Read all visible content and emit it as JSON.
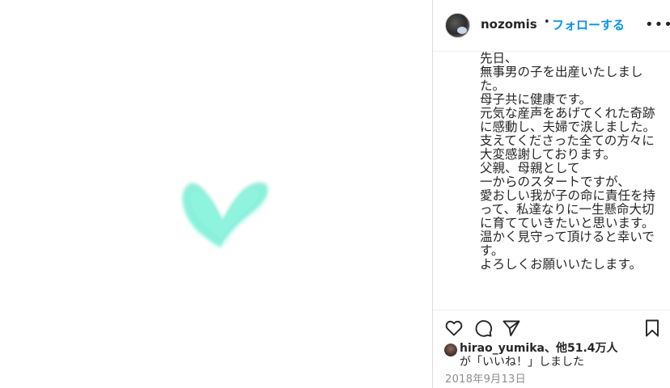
{
  "post": {
    "username": "nozomis",
    "separator": "•",
    "follow_label": "フォローする",
    "more_label": "•••",
    "caption": "先日、\n無事男の子を出産いたしました。\n母子共に健康です。\n元気な産声をあげてくれた奇跡に感動し、夫婦で涙しました。\n支えてくださった全ての方々に\n大変感謝しております。\n父親、母親として\n一からのスタートですが、\n愛おしい我が子の命に責任を持って、私達なりに一生懸命大切に育てていきたいと思います。\n温かく見守って頂けると幸いです。\nよろしくお願いいたします。",
    "media_icon": "heart-drawing",
    "media_color": "#7fefd6",
    "accent_color": "#0095f6"
  },
  "actions": {
    "like_icon": "heart-outline-icon",
    "comment_icon": "comment-icon",
    "share_icon": "share-icon",
    "save_icon": "bookmark-icon"
  },
  "likes": {
    "liker": "hirao_yumika",
    "joiner": "、他",
    "count": "51.4万人",
    "tail": "が「いいね！」しました"
  },
  "date": "2018年9月13日"
}
